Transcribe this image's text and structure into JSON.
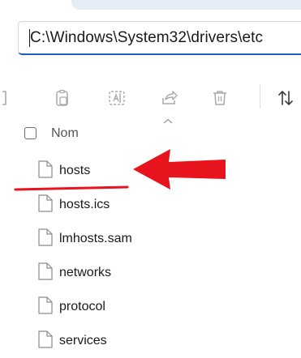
{
  "address": {
    "path": "C:\\Windows\\System32\\drivers\\etc"
  },
  "toolbar": {
    "buttons": [
      {
        "name": "cut",
        "icon": "cut-icon"
      },
      {
        "name": "copy",
        "icon": "copy-icon"
      },
      {
        "name": "rename",
        "icon": "rename-icon"
      },
      {
        "name": "share",
        "icon": "share-icon"
      },
      {
        "name": "delete",
        "icon": "trash-icon"
      },
      {
        "name": "sort",
        "icon": "sort-icon"
      }
    ]
  },
  "list": {
    "column_header": "Nom",
    "files": [
      {
        "name": "hosts"
      },
      {
        "name": "hosts.ics"
      },
      {
        "name": "lmhosts.sam"
      },
      {
        "name": "networks"
      },
      {
        "name": "protocol"
      },
      {
        "name": "services"
      }
    ]
  },
  "annotation": {
    "arrow_color": "#e8141d",
    "underline_color": "#e8141d"
  },
  "colors": {
    "accent": "#1f5fbf",
    "icon_gray": "#a9a9a9"
  }
}
